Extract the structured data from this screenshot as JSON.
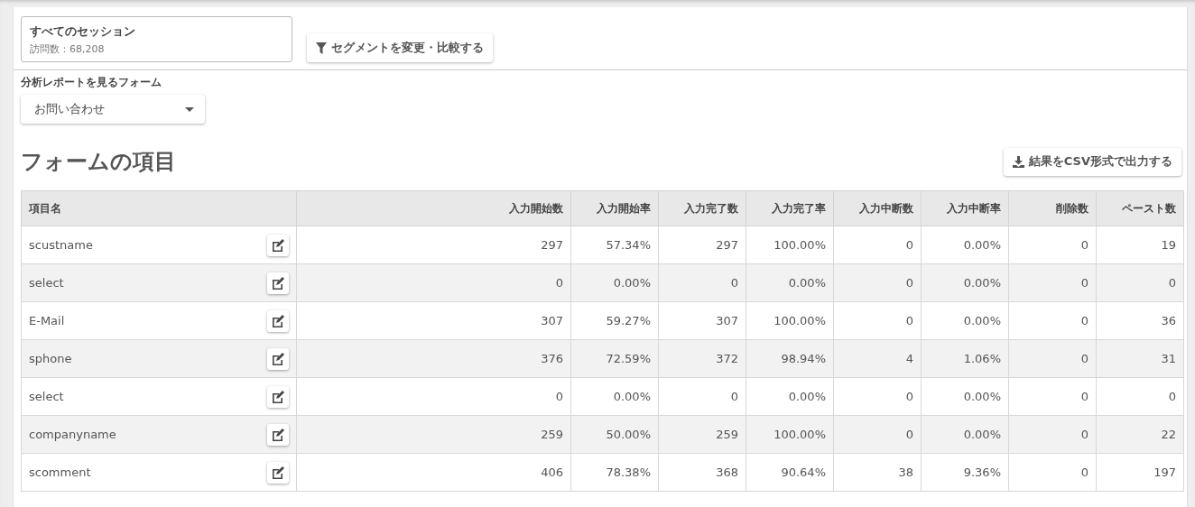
{
  "segment": {
    "title": "すべてのセッション",
    "visits": "訪問数：68,208"
  },
  "segment_button": "セグメントを変更・比較する",
  "form_selector": {
    "label": "分析レポートを見るフォーム",
    "value": "お問い合わせ"
  },
  "section_title": "フォームの項目",
  "export_button": "結果をCSV形式で出力する",
  "table": {
    "columns": [
      "項目名",
      "入力開始数",
      "入力開始率",
      "入力完了数",
      "入力完了率",
      "入力中断数",
      "入力中断率",
      "削除数",
      "ペースト数"
    ],
    "rows": [
      {
        "cells": [
          "scustname",
          "297",
          "57.34%",
          "297",
          "100.00%",
          "0",
          "0.00%",
          "0",
          "19"
        ]
      },
      {
        "cells": [
          "select",
          "0",
          "0.00%",
          "0",
          "0.00%",
          "0",
          "0.00%",
          "0",
          "0"
        ]
      },
      {
        "cells": [
          "E-Mail",
          "307",
          "59.27%",
          "307",
          "100.00%",
          "0",
          "0.00%",
          "0",
          "36"
        ]
      },
      {
        "cells": [
          "sphone",
          "376",
          "72.59%",
          "372",
          "98.94%",
          "4",
          "1.06%",
          "0",
          "31"
        ]
      },
      {
        "cells": [
          "select",
          "0",
          "0.00%",
          "0",
          "0.00%",
          "0",
          "0.00%",
          "0",
          "0"
        ]
      },
      {
        "cells": [
          "companyname",
          "259",
          "50.00%",
          "259",
          "100.00%",
          "0",
          "0.00%",
          "0",
          "22"
        ]
      },
      {
        "cells": [
          "scomment",
          "406",
          "78.38%",
          "368",
          "90.64%",
          "38",
          "9.36%",
          "0",
          "197"
        ]
      }
    ]
  }
}
